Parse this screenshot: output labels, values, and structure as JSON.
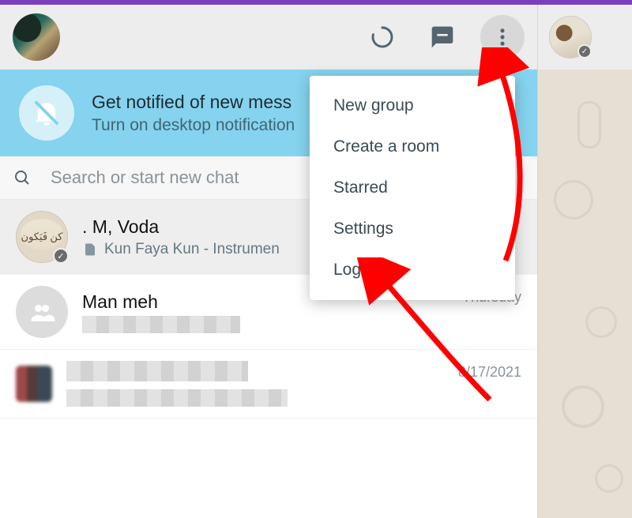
{
  "notification": {
    "title": "Get notified of new mess",
    "subtitle": "Turn on desktop notification"
  },
  "search": {
    "placeholder": "Search or start new chat"
  },
  "menu": {
    "items": [
      {
        "label": "New group"
      },
      {
        "label": "Create a room"
      },
      {
        "label": "Starred"
      },
      {
        "label": "Settings"
      },
      {
        "label": "Log out"
      }
    ]
  },
  "chats": [
    {
      "name": ". M, Voda",
      "preview": "Kun Faya Kun - Instrumen",
      "time": ""
    },
    {
      "name": "Man meh",
      "preview": "",
      "time": "Thursday"
    },
    {
      "name": "",
      "preview": "",
      "time": "8/17/2021"
    }
  ]
}
